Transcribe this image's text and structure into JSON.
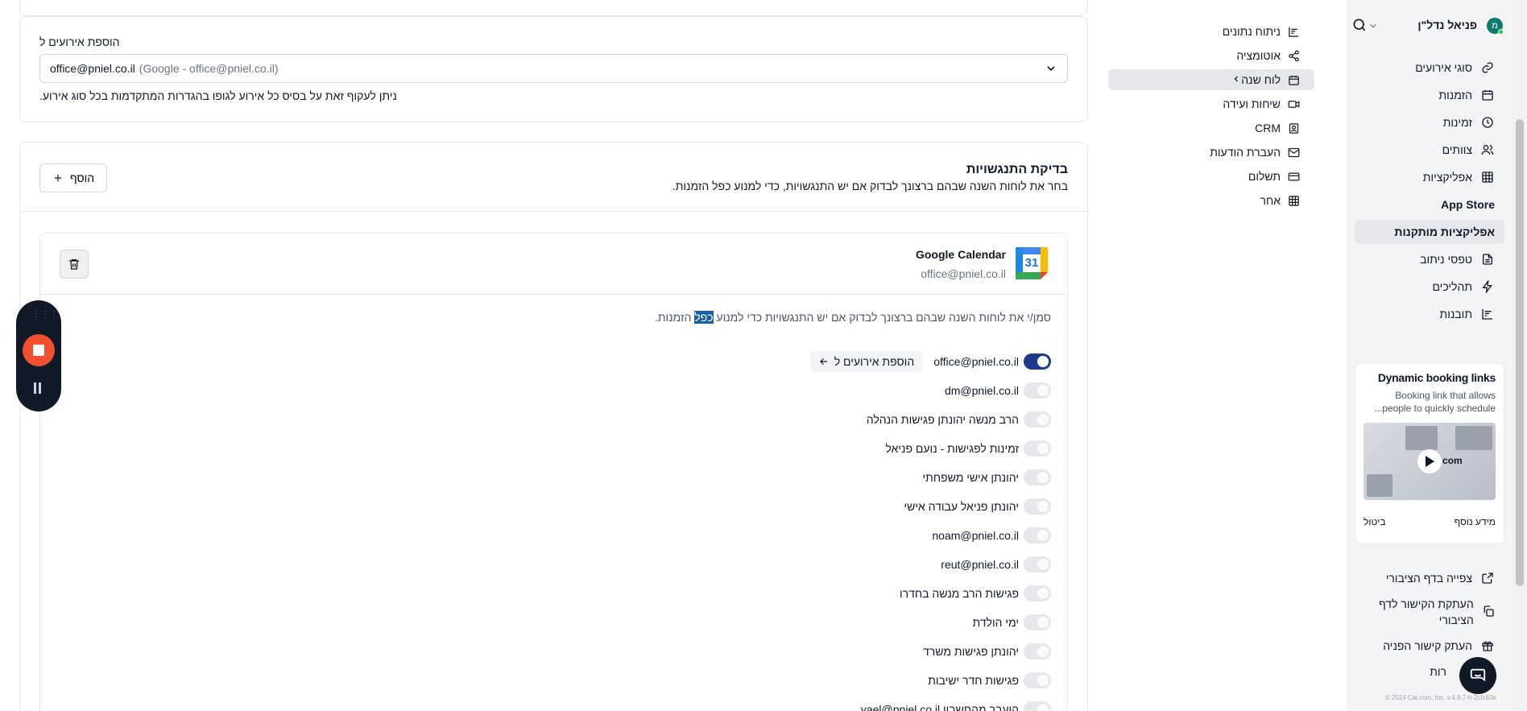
{
  "sidebar": {
    "avatar_initial": "מ",
    "user_name": "פניאל נדל\"ן",
    "items": [
      {
        "label": "סוגי אירועים",
        "icon": "link-icon"
      },
      {
        "label": "הזמנות",
        "icon": "calendar-icon"
      },
      {
        "label": "זמינות",
        "icon": "clock-icon"
      },
      {
        "label": "צוותים",
        "icon": "users-icon"
      },
      {
        "label": "אפליקציות",
        "icon": "grid-icon"
      },
      {
        "label": "App Store",
        "icon": ""
      },
      {
        "label": "אפליקציות מותקנות",
        "icon": ""
      },
      {
        "label": "טפסי ניתוב",
        "icon": "file-icon"
      },
      {
        "label": "תהליכים",
        "icon": "zap-icon"
      },
      {
        "label": "תובנות",
        "icon": "chart-icon"
      }
    ],
    "promo": {
      "title": "Dynamic booking links",
      "description": "Booking link that allows people to quickly schedule...",
      "more_info": "מידע נוסף",
      "dismiss": "ביטול",
      "video_caption": "com"
    },
    "bottom": [
      {
        "label": "צפייה בדף הציבורי",
        "icon": "external-link-icon"
      },
      {
        "label": "העתקת הקישור לדף הציבורי",
        "icon": "copy-icon"
      },
      {
        "label": "העתק קישור הפניה",
        "icon": "gift-icon"
      },
      {
        "label": "רות",
        "icon": ""
      }
    ],
    "version": "© 2024 Cal.com, Inc. v.4.8.7-h-2cfc83e"
  },
  "settings_nav": [
    {
      "label": "ניתוח נתונים",
      "icon": "chart-icon"
    },
    {
      "label": "אוטומציה",
      "icon": "share-icon"
    },
    {
      "label": "לוח שנה",
      "icon": "calendar-icon",
      "active": true
    },
    {
      "label": "שיחות ועידה",
      "icon": "video-icon"
    },
    {
      "label": "CRM",
      "icon": "contact-icon"
    },
    {
      "label": "העברת הודעות",
      "icon": "mail-icon"
    },
    {
      "label": "תשלום",
      "icon": "card-icon"
    },
    {
      "label": "אחר",
      "icon": "grid-icon"
    }
  ],
  "add_events": {
    "label": "הוספת אירועים ל",
    "selected_value": "office@pniel.co.il",
    "selected_sub": "(Google - office@pniel.co.il)",
    "hint": "ניתן לעקוף זאת על בסיס כל אירוע לגופו בהגדרות המתקדמות בכל סוג אירוע."
  },
  "conflict": {
    "title": "בדיקת התנגשויות",
    "description": "בחר את לוחות השנה שבהם ברצונך לבדוק אם יש התנגשויות, כדי למנוע כפל הזמנות.",
    "add_button": "הוסף"
  },
  "calendar": {
    "name": "Google Calendar",
    "email": "office@pniel.co.il",
    "logo_text": "31",
    "intro_before": "סמן/י את לוחות השנה שבהם ברצונך לבדוק אם יש התנגשויות כדי למנוע ",
    "intro_highlight": "כפל",
    "intro_after": " הזמנות.",
    "dest_chip": "הוספת אירועים ל",
    "list": [
      {
        "name": "office@pniel.co.il",
        "on": true
      },
      {
        "name": "dm@pniel.co.il",
        "on": false
      },
      {
        "name": "הרב מנשה יהונתן פגישות הנהלה",
        "on": false
      },
      {
        "name": "זמינות לפגישות - נועם פניאל",
        "on": false
      },
      {
        "name": "יהונתן אישי משפחתי",
        "on": false
      },
      {
        "name": "יהונתן פניאל עבודה אישי",
        "on": false
      },
      {
        "name": "noam@pniel.co.il",
        "on": false
      },
      {
        "name": "reut@pniel.co.il",
        "on": false
      },
      {
        "name": "פגישות הרב מנשה בחדרו",
        "on": false
      },
      {
        "name": "ימי הולדת",
        "on": false
      },
      {
        "name": "יהונתן פגישות משרד",
        "on": false
      },
      {
        "name": "פגישות חדר ישיבות",
        "on": false
      },
      {
        "name": "הועבר מהחשבון yael@pniel.co.il",
        "on": false
      }
    ]
  }
}
